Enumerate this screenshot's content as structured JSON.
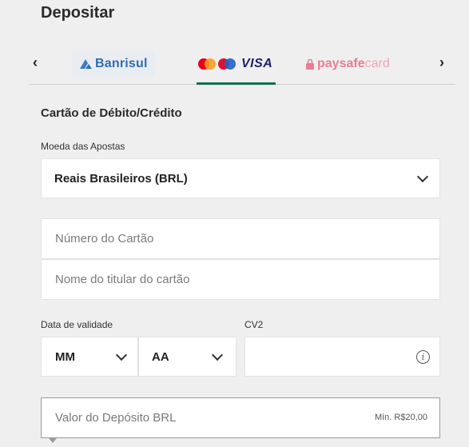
{
  "page": {
    "title": "Depositar"
  },
  "methods": {
    "prev_icon": "chevron-left-icon",
    "next_icon": "chevron-right-icon",
    "banrisul_label": "Banrisul",
    "cards_label": "VISA",
    "paysafe_label_1": "paysafe",
    "paysafe_label_2": "card",
    "active": "cards",
    "active_color": "#126e51"
  },
  "form": {
    "section_title": "Cartão de Débito/Crédito",
    "currency_label": "Moeda das Apostas",
    "currency_value": "Reais Brasileiros (BRL)",
    "card_number_placeholder": "Número do Cartão",
    "card_holder_placeholder": "Nome do titular do cartão",
    "expiry_label": "Data de validade",
    "month_value": "MM",
    "year_value": "AA",
    "cv2_label": "CV2",
    "cv2_info_glyph": "i",
    "amount_placeholder": "Valor do Depósito BRL",
    "amount_min": "Mín. R$20,00"
  }
}
